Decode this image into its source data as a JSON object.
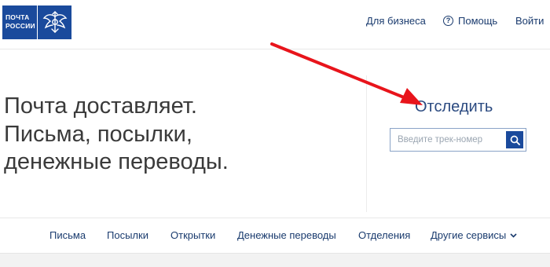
{
  "logo": {
    "line1": "ПОЧТА",
    "line2": "РОССИИ",
    "brand_color": "#1a4a9c"
  },
  "topnav": {
    "business": "Для бизнеса",
    "help": "Помощь",
    "help_icon": "question-circle-icon",
    "login": "Войти"
  },
  "hero": {
    "line1": "Почта доставляет.",
    "line2": "Письма, посылки,",
    "line3": "денежные переводы."
  },
  "tracking": {
    "title": "Отследить",
    "placeholder": "Введите трек-номер",
    "value": "",
    "search_icon": "search-icon"
  },
  "bottomnav": {
    "items": [
      "Письма",
      "Посылки",
      "Открытки",
      "Денежные переводы",
      "Отделения",
      "Другие сервисы"
    ],
    "more_icon": "chevron-down-icon"
  },
  "annotation": {
    "arrow_color": "#e8141b"
  },
  "colors": {
    "link": "#1a3b6e",
    "heading": "#2b4a80"
  }
}
